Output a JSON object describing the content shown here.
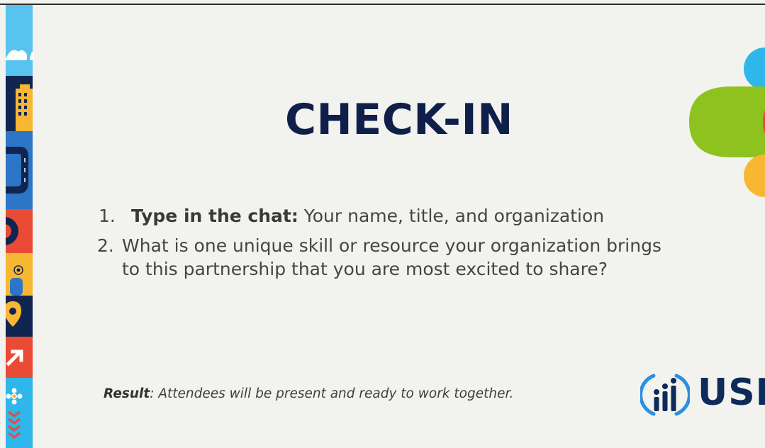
{
  "slide": {
    "title": "CHECK-IN",
    "items": [
      {
        "number": "1.",
        "lead": "Type in the chat:",
        "text": " Your name, title, and organization"
      },
      {
        "number": "2.",
        "text": "What is one unique skill or resource your organization brings to this partnership that you are most excited to share?"
      }
    ],
    "result": {
      "label": "Result",
      "text": ": Attendees will be present and ready to work together."
    },
    "logo": {
      "text": "USI"
    }
  },
  "colors": {
    "background": "#f2f2ee",
    "title": "#0f1f49",
    "body_text": "#454545",
    "logo_blue": "#0e2a5a",
    "accent_green": "#8dc21f",
    "accent_sky": "#2fb6ea",
    "accent_yellow": "#f7b733",
    "accent_red": "#e94b35"
  },
  "icons": [
    "building-icon",
    "road-icon",
    "location-pin-icon",
    "arrow-up-right-icon",
    "flower-icon",
    "usi-logo-icon"
  ]
}
